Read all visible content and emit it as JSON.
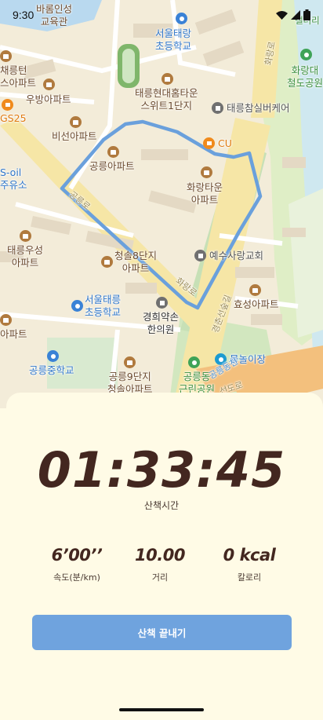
{
  "status_bar": {
    "time": "9:30"
  },
  "map": {
    "labels": {
      "baroom": "바롬인성\n교육관",
      "seoul_taereung_elem": "서울태랑\n초등학교",
      "hwarangro": "화랑로",
      "hwarangdae": "화랑대\n철도공원",
      "gallery": "갤러리",
      "chaeryeon": "채릉턴\n스아파트",
      "ubang": "우방아파트",
      "taereung_hyundai": "태릉현대홈타운\n스위트1단지",
      "taereung_care": "태릉참실버케어",
      "gs25": "GS25",
      "bisun": "비선아파트",
      "cu": "CU",
      "soil": "S-oil\n주유소",
      "gongneung_apt": "공릉아파트",
      "hwarang_town": "화랑타운\n아파트",
      "taereung_woosung": "태릉우성\n아파트",
      "cheongsol8": "청솔8단지\n아파트",
      "yesu_church": "예수사랑교회",
      "seoul_taereung_elem2": "서울태릉\n초등학교",
      "hyosung": "효성아파트",
      "kyunghee": "경희약손\n한의원",
      "apt_left": "아파트",
      "mulnori": "물놀이장",
      "gongneung_middle": "공릉중학교",
      "gongneung9": "공릉9단지\n청솔아파트",
      "gongneung_park": "공릉동\n근린공원",
      "road_left": "공릉로",
      "road_mid": "화랑로",
      "road_line": "경춘선숲길",
      "road_bottom": "공릉동천",
      "road_seonddong": "선도로"
    }
  },
  "workout": {
    "elapsed_time": "01:33:45",
    "elapsed_label": "산책시간",
    "pace": {
      "value": "6’00’’",
      "label": "속도(분/km)"
    },
    "distance": {
      "value": "10.00",
      "label": "거리"
    },
    "calories": {
      "value": "0 kcal",
      "label": "칼로리"
    }
  },
  "actions": {
    "end_walk_label": "산책 끝내기"
  },
  "colors": {
    "background": "#fffbe6",
    "accent_button": "#6fa3de",
    "timer_text": "#432720",
    "route_line": "#6aa0dc"
  }
}
